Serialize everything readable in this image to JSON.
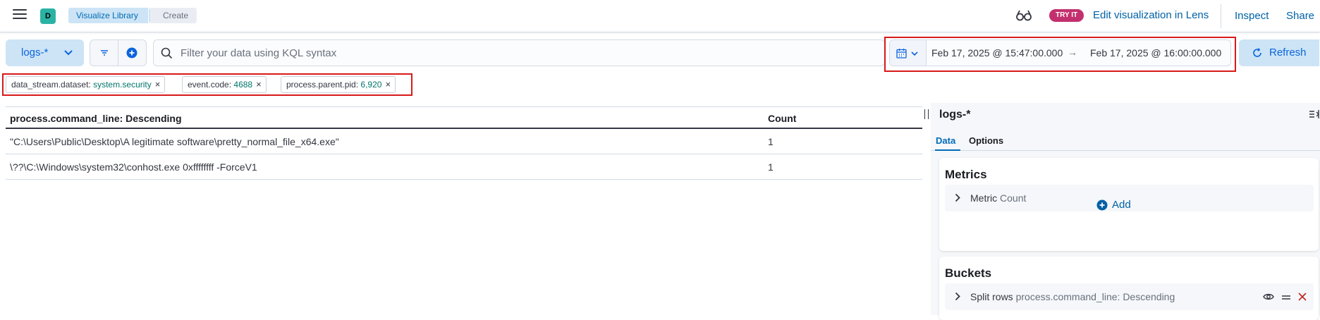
{
  "header": {
    "space_initial": "D",
    "breadcrumbs": [
      "Visualize Library",
      "Create"
    ],
    "try_badge": "TRY IT",
    "lens_link": "Edit visualization in Lens",
    "inspect": "Inspect",
    "share": "Share"
  },
  "query_bar": {
    "data_view": "logs-*",
    "placeholder": "Filter your data using KQL syntax",
    "time_start": "Feb 17, 2025 @ 15:47:00.000",
    "time_arrow": "→",
    "time_end": "Feb 17, 2025 @ 16:00:00.000",
    "refresh": "Refresh"
  },
  "filters": [
    {
      "key": "data_stream.dataset: ",
      "value": "system.security"
    },
    {
      "key": "event.code: ",
      "value": "4688"
    },
    {
      "key": "process.parent.pid: ",
      "value": "6,920"
    }
  ],
  "table": {
    "columns": [
      "process.command_line: Descending",
      "Count"
    ],
    "rows": [
      [
        "\"C:\\Users\\Public\\Desktop\\A legitimate software\\pretty_normal_file_x64.exe\"",
        "1"
      ],
      [
        "\\??\\C:\\Windows\\system32\\conhost.exe 0xffffffff -ForceV1",
        "1"
      ]
    ]
  },
  "sidebar": {
    "title": "logs-*",
    "tabs": [
      "Data",
      "Options"
    ],
    "metrics": {
      "title": "Metrics",
      "row_label": "Metric",
      "row_sub": "Count",
      "add": "Add"
    },
    "buckets": {
      "title": "Buckets",
      "row_label": "Split rows",
      "row_sub": "process.command_line: Descending"
    }
  },
  "colors": {
    "accent": "#0b64dd",
    "link": "#0061a6",
    "highlight": "#d71a1a",
    "filter_value": "#00766b",
    "try_badge": "#c3306e"
  }
}
